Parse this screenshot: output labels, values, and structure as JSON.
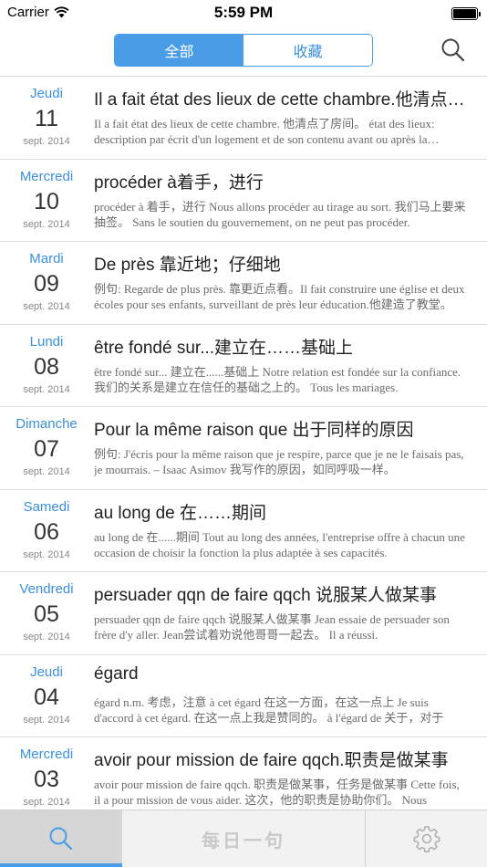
{
  "status_bar": {
    "carrier": "Carrier",
    "time": "5:59 PM"
  },
  "nav": {
    "segments": [
      {
        "label": "全部",
        "active": true
      },
      {
        "label": "收藏",
        "active": false
      }
    ],
    "search_icon": "search-icon"
  },
  "entries": [
    {
      "weekday": "Jeudi",
      "day": "11",
      "month_year": "sept. 2014",
      "title": "Il a fait état des lieux de cette chambre.他清点了房间。",
      "snippet": "Il a fait état des lieux de cette chambre.  他清点了房间。    état des lieux: description par écrit d'un logement et de son contenu avant ou après la location."
    },
    {
      "weekday": "Mercredi",
      "day": "10",
      "month_year": "sept. 2014",
      "title": "procéder à着手，进行",
      "snippet": "procéder à  着手，进行    Nous allons procéder au tirage au sort.  我们马上要来抽签。    Sans le  soutien du gouvernement, on ne peut pas procéder."
    },
    {
      "weekday": "Mardi",
      "day": "09",
      "month_year": "sept. 2014",
      "title": "De près 靠近地；仔细地",
      "snippet": "例句:    Regarde de plus près. 靠更近点看。Il fait construire une église et deux écoles pour ses enfants, surveillant de près leur éducation.他建造了教堂。"
    },
    {
      "weekday": "Lundi",
      "day": "08",
      "month_year": "sept. 2014",
      "title": "être fondé sur...建立在……基础上",
      "snippet": "être fondé sur...   建立在......基础上    Notre relation est fondée sur la confiance.  我们的关系是建立在信任的基础之上的。    Tous les mariages."
    },
    {
      "weekday": "Dimanche",
      "day": "07",
      "month_year": "sept. 2014",
      "title": "Pour la même raison que 出于同样的原因",
      "snippet": "例句:    J'écris pour la même raison que je respire, parce que je ne le faisais pas, je mourrais.  – Isaac Asimov 我写作的原因，如同呼吸一样。"
    },
    {
      "weekday": "Samedi",
      "day": "06",
      "month_year": "sept. 2014",
      "title": "au long de 在……期间",
      "snippet": "au long de    在......期间    Tout au long des années, l'entreprise offre à chacun une occasion de choisir la fonction la plus adaptée à ses capacités."
    },
    {
      "weekday": "Vendredi",
      "day": "05",
      "month_year": "sept. 2014",
      "title": "persuader qqn de faire qqch 说服某人做某事",
      "snippet": "persuader qqn de faire qqch    说服某人做某事    Jean essaie de persuader son frère d'y aller.  Jean尝试着劝说他哥哥一起去。    Il a réussi."
    },
    {
      "weekday": "Jeudi",
      "day": "04",
      "month_year": "sept. 2014",
      "title": "égard",
      "snippet": "égard    n.m. 考虑，注意    à cet égard 在这一方面，在这一点上  Je suis d'accord à cet égard.  在这一点上我是赞同的。    à l'égard de 关于，对于"
    },
    {
      "weekday": "Mercredi",
      "day": "03",
      "month_year": "sept. 2014",
      "title": "avoir pour mission de faire qqch.职责是做某事",
      "snippet": "avoir pour mission de faire qqch.  职责是做某事，任务是做某事    Cette fois, il a pour mission de vous aider.  这次，他的职责是协助你们。    Nous"
    }
  ],
  "tab_bar": {
    "center_label": "每日一句",
    "left_icon": "search-icon",
    "right_icon": "gear-icon"
  },
  "colors": {
    "accent": "#4a9ce6",
    "weekday": "#3a8fe0"
  }
}
